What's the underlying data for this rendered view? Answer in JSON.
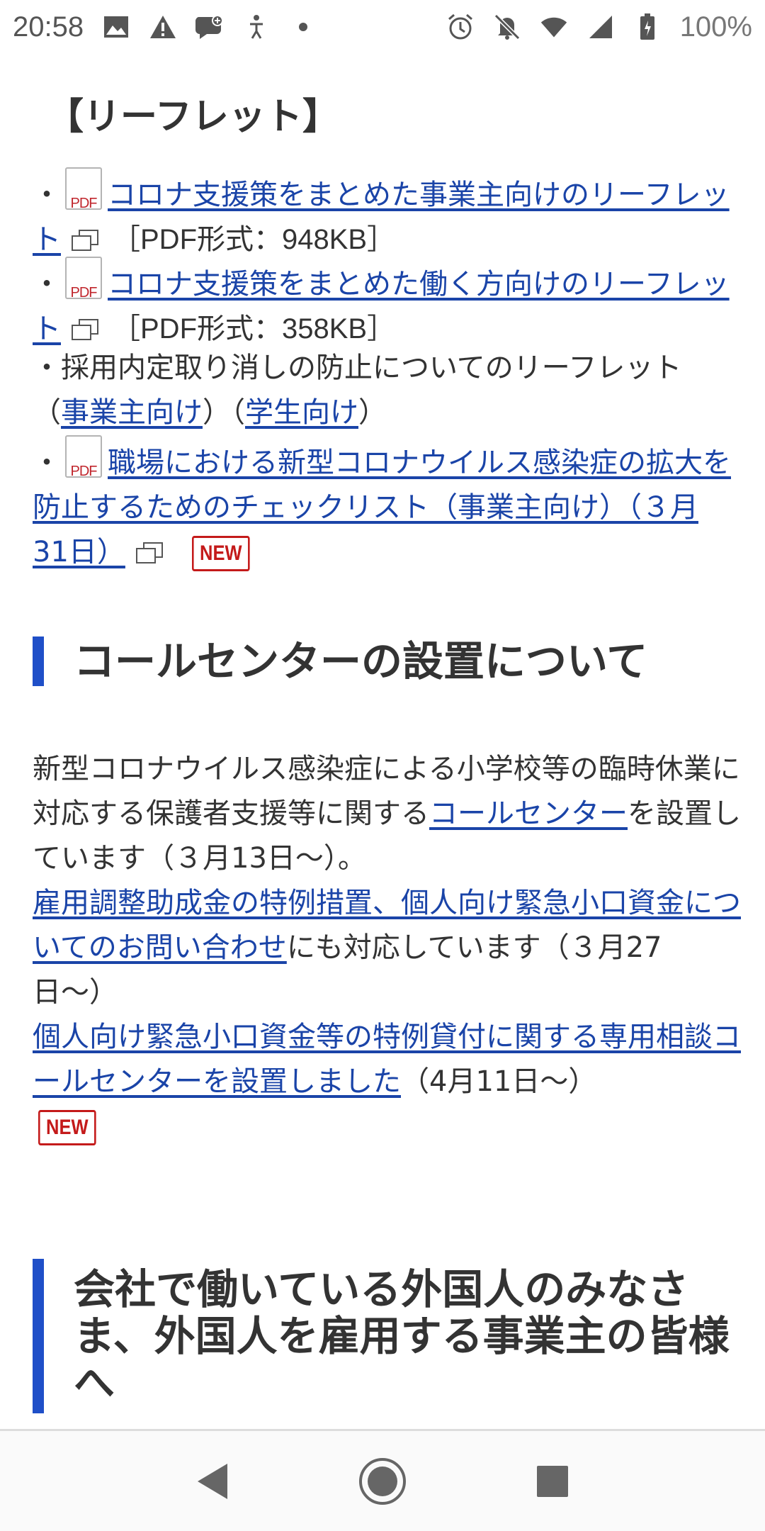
{
  "status_bar": {
    "time": "20:58",
    "battery": "100%",
    "left_icons": [
      "image-icon",
      "warning-icon",
      "chat-add-icon",
      "accessibility-icon",
      "dot-icon"
    ],
    "right_icons": [
      "alarm-icon",
      "bell-off-icon",
      "wifi-icon",
      "signal-icon",
      "battery-icon"
    ]
  },
  "leaflet_section": {
    "title": "【リーフレット】",
    "items": [
      {
        "bullet": "・",
        "link": "コロナ支援策をまとめた事業主向けのリーフレット",
        "meta": "［PDF形式：948KB］"
      },
      {
        "bullet": "・",
        "link": "コロナ支援策をまとめた働く方向けのリーフレット",
        "meta": "［PDF形式：358KB］"
      },
      {
        "bullet": "・",
        "text": "採用内定取り消しの防止についてのリーフレット",
        "open1": "（",
        "link_employer": "事業主向け",
        "close1": "）",
        "open2": "（",
        "link_student": "学生向け",
        "close2": "）"
      },
      {
        "bullet": "・",
        "link": "職場における新型コロナウイルス感染症の拡大を防止するためのチェックリスト（事業主向け）（３月31日）",
        "badge": "NEW"
      }
    ],
    "pdf_icon_label": "PDF"
  },
  "call_center_section": {
    "heading": "コールセンターの設置について",
    "p1_text": "新型コロナウイルス感染症による小学校等の臨時休業に対応する保護者支援等に関する",
    "p1_link": "コールセンター",
    "p1_after": "を設置しています（３月13日〜）。",
    "p2_link": "雇用調整助成金の特例措置、個人向け緊急小口資金についてのお問い合わせ",
    "p2_after": "にも対応しています（３月27日〜）",
    "p3_link": "個人向け緊急小口資金等の特例貸付に関する専用相談コールセンターを設置しました",
    "p3_after": "（4月11日〜）",
    "badge": "NEW"
  },
  "foreign_section": {
    "heading": "会社で働いている外国人のみなさま、外国人を雇用する事業主の皆様へ"
  },
  "nav_bar": {
    "buttons": [
      "back-icon",
      "home-icon",
      "recents-icon"
    ]
  },
  "colors": {
    "link": "#1a44a8",
    "accent_bar": "#1f4fc8",
    "badge": "#c41a1a",
    "text": "#333333"
  }
}
